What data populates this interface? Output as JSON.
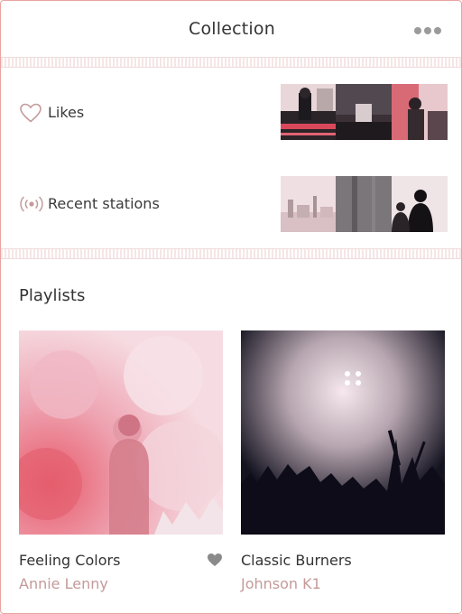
{
  "header": {
    "title": "Collection",
    "more_icon": "ellipsis-icon"
  },
  "collection": {
    "likes": {
      "label": "Likes",
      "icon": "heart-outline-icon"
    },
    "recent": {
      "label": "Recent stations",
      "icon": "radio-broadcast-icon"
    }
  },
  "playlists": {
    "title": "Playlists",
    "items": [
      {
        "name": "Feeling Colors",
        "author": "Annie Lenny",
        "liked": true
      },
      {
        "name": "Classic Burners",
        "author": "Johnson K1",
        "liked": false
      }
    ]
  },
  "colors": {
    "accent": "#c49a9a",
    "border": "#e8a3a0",
    "text": "#333333"
  }
}
